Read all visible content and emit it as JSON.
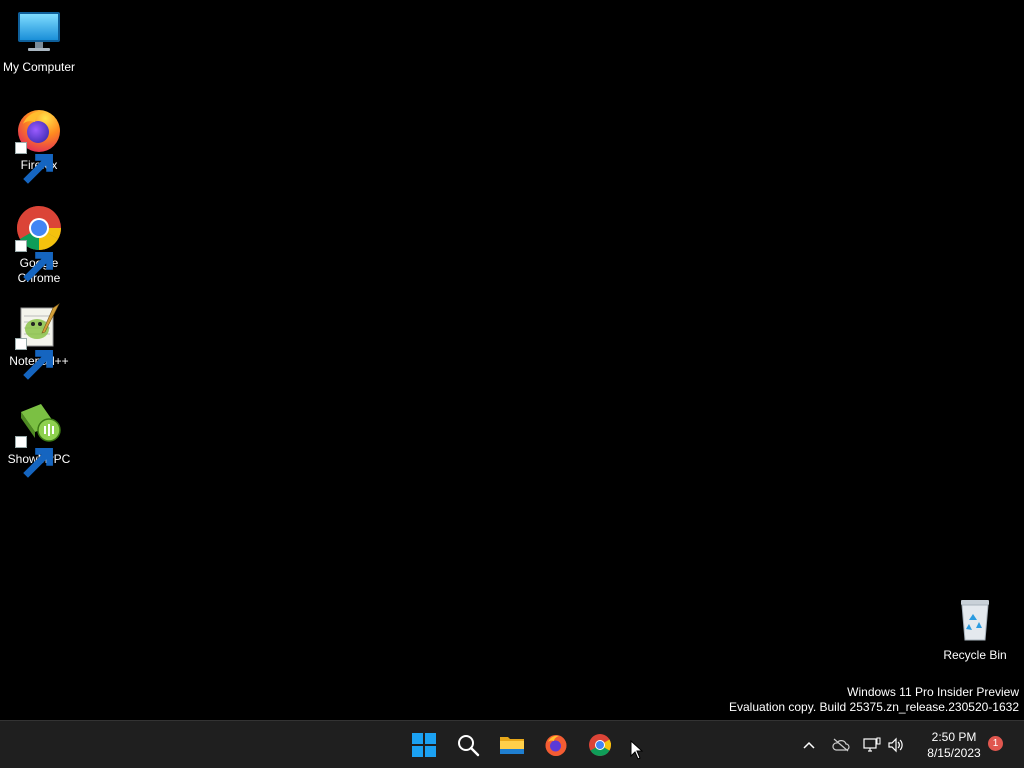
{
  "desktop": {
    "icons": [
      {
        "label": "My Computer",
        "icon": "monitor-icon"
      },
      {
        "label": "Firefox",
        "icon": "firefox-icon"
      },
      {
        "label": "Google Chrome",
        "icon": "chrome-icon"
      },
      {
        "label": "Notepad++",
        "icon": "notepadpp-icon"
      },
      {
        "label": "ShowMyPC",
        "icon": "showmypc-icon"
      }
    ],
    "recycle_bin": {
      "label": "Recycle Bin",
      "icon": "recycle-bin-icon"
    },
    "watermark": {
      "line1": "Windows 11 Pro Insider Preview",
      "line2": "Evaluation copy. Build 25375.zn_release.230520-1632"
    }
  },
  "taskbar": {
    "pinned": [
      "start-icon",
      "search-icon",
      "file-explorer-icon",
      "firefox-icon",
      "chrome-icon"
    ],
    "tray": [
      "chevron-up-icon",
      "onedrive-offline-icon",
      "network-icon",
      "volume-icon"
    ],
    "clock": {
      "time": "2:50 PM",
      "date": "8/15/2023"
    },
    "notification_count": "1"
  },
  "colors": {
    "taskbar_bg": "#1f1f1f",
    "desktop_bg": "#000000",
    "windows_blue": "#1ba1f2",
    "notification_badge": "#e0574f"
  }
}
